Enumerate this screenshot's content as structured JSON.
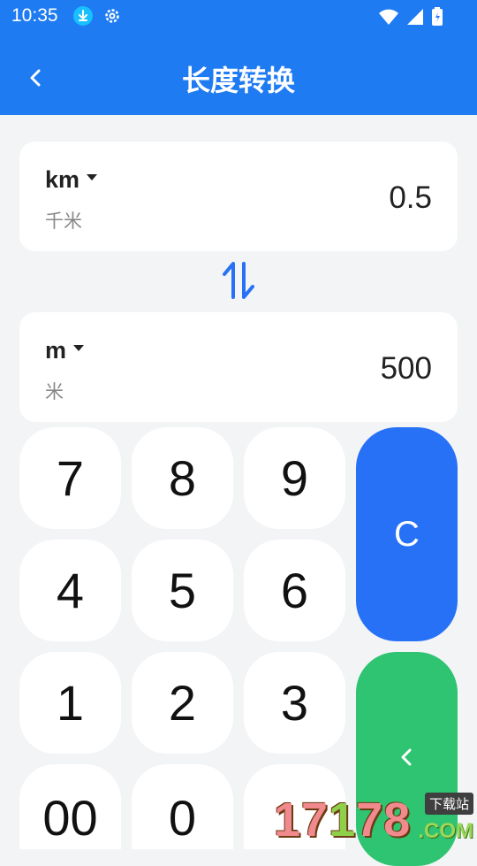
{
  "status_bar": {
    "time": "10:35",
    "icons": [
      "download-icon",
      "gear-icon",
      "wifi-icon",
      "signal-icon",
      "battery-icon"
    ]
  },
  "header": {
    "title": "长度转换",
    "back_icon": "chevron-left-icon",
    "background_color": "#1e7bf2"
  },
  "from": {
    "unit": "km",
    "unit_name": "千米",
    "value": "0.5"
  },
  "swap_icon": "swap-vertical-icon",
  "to": {
    "unit": "m",
    "unit_name": "米",
    "value": "500"
  },
  "keypad": {
    "keys": [
      "7",
      "8",
      "9",
      "4",
      "5",
      "6",
      "1",
      "2",
      "3",
      "00",
      "0",
      "."
    ],
    "clear_label": "C",
    "clear_color": "#2771f7",
    "backspace_icon": "chevron-left-icon",
    "backspace_color": "#2ec471"
  },
  "watermark": {
    "number_a": "17",
    "number_b": "1",
    "number_c": "78",
    "domain": ".COM",
    "tag": "下载站"
  }
}
